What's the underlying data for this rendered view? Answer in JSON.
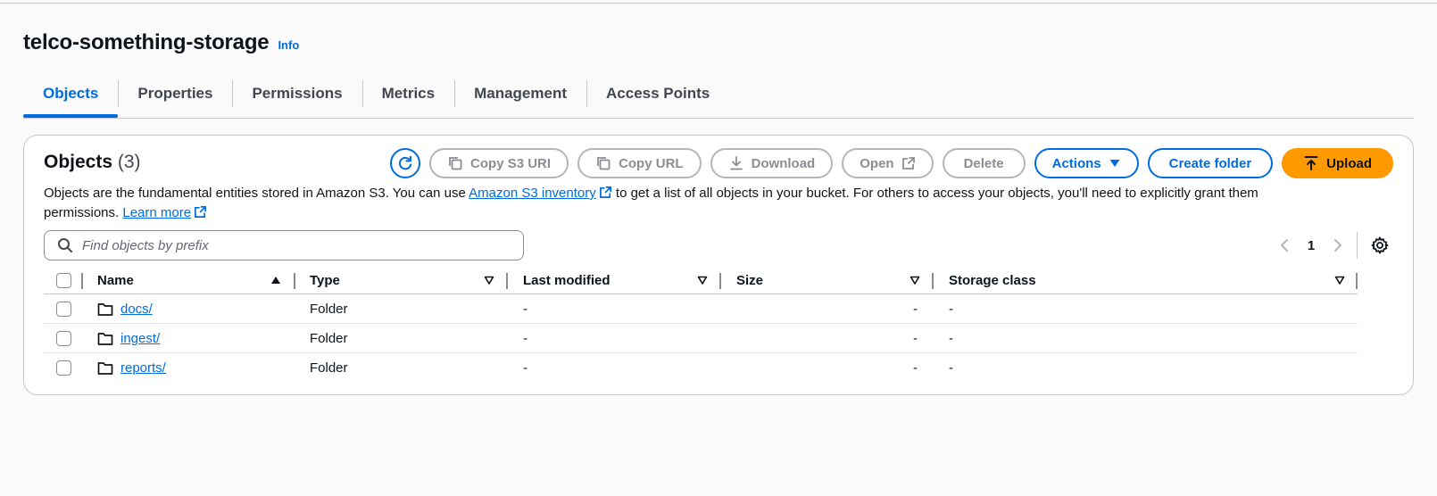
{
  "bucket": {
    "name": "telco-something-storage",
    "info_label": "Info"
  },
  "tabs": [
    {
      "label": "Objects",
      "active": true
    },
    {
      "label": "Properties"
    },
    {
      "label": "Permissions"
    },
    {
      "label": "Metrics"
    },
    {
      "label": "Management"
    },
    {
      "label": "Access Points"
    }
  ],
  "objects_panel": {
    "title": "Objects",
    "count": "(3)",
    "description_part1": "Objects are the fundamental entities stored in Amazon S3. You can use",
    "inventory_link": "Amazon S3 inventory",
    "description_part2": "to get a list of all objects in your bucket. For others to access your objects, you'll need to explicitly grant them permissions.",
    "learn_more": "Learn more"
  },
  "toolbar": {
    "copy_s3_uri": "Copy S3 URI",
    "copy_url": "Copy URL",
    "download": "Download",
    "open": "Open",
    "delete": "Delete",
    "actions": "Actions",
    "create_folder": "Create folder",
    "upload": "Upload"
  },
  "search": {
    "placeholder": "Find objects by prefix"
  },
  "pagination": {
    "current_page": "1"
  },
  "table": {
    "columns": [
      "Name",
      "Type",
      "Last modified",
      "Size",
      "Storage class"
    ],
    "rows": [
      {
        "name": "docs/",
        "type": "Folder",
        "last_modified": "-",
        "size": "-",
        "storage_class": "-"
      },
      {
        "name": "ingest/",
        "type": "Folder",
        "last_modified": "-",
        "size": "-",
        "storage_class": "-"
      },
      {
        "name": "reports/",
        "type": "Folder",
        "last_modified": "-",
        "size": "-",
        "storage_class": "-"
      }
    ]
  },
  "colors": {
    "accent": "#006ce0",
    "upload": "#ff9900",
    "disabled": "#8c8c94"
  },
  "icons": [
    "refresh-icon",
    "copy-icon",
    "download-icon",
    "external-link-icon",
    "caret-down-icon",
    "upload-arrow-icon",
    "search-icon",
    "chevron-left-icon",
    "chevron-right-icon",
    "gear-icon",
    "folder-icon",
    "sort-ascending-icon",
    "sort-icon"
  ]
}
